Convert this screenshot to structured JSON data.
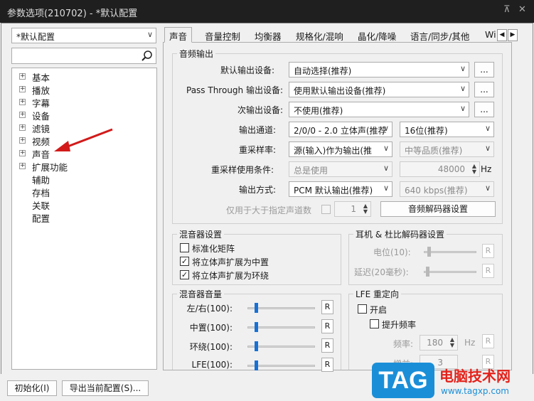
{
  "window": {
    "title": "参数选项(210702) - *默认配置",
    "pin_icon": "pin-icon",
    "close_icon": "close-icon"
  },
  "sidebar": {
    "profile_select": "*默认配置",
    "search_icon": "search-icon",
    "tree": [
      {
        "label": "基本",
        "expandable": true
      },
      {
        "label": "播放",
        "expandable": true
      },
      {
        "label": "字幕",
        "expandable": true
      },
      {
        "label": "设备",
        "expandable": true
      },
      {
        "label": "滤镜",
        "expandable": true
      },
      {
        "label": "视频",
        "expandable": true
      },
      {
        "label": "声音",
        "expandable": true
      },
      {
        "label": "扩展功能",
        "expandable": true
      },
      {
        "label": "辅助",
        "expandable": false
      },
      {
        "label": "存档",
        "expandable": false
      },
      {
        "label": "关联",
        "expandable": false
      },
      {
        "label": "配置",
        "expandable": false
      }
    ]
  },
  "tabs": [
    "声音",
    "音量控制",
    "均衡器",
    "规格化/混响",
    "晶化/降噪",
    "语言/同步/其他",
    "Wi"
  ],
  "audio_output": {
    "title": "音频输出",
    "default_device_label": "默认输出设备:",
    "default_device_value": "自动选择(推荐)",
    "passthrough_label": "Pass Through 输出设备:",
    "passthrough_value": "使用默认输出设备(推荐)",
    "secondary_label": "次输出设备:",
    "secondary_value": "不使用(推荐)",
    "ellipsis": "...",
    "channel_label": "输出通道:",
    "channel_value": "2/0/0 - 2.0 立体声(推荐",
    "bit_value": "16位(推荐)",
    "resample_label": "重采样率:",
    "resample_value": "源(输入)作为输出(推",
    "quality_value": "中等品质(推荐)",
    "resample_cond_label": "重采样使用条件:",
    "resample_cond_value": "总是使用",
    "rate_value": "48000",
    "rate_unit": "Hz",
    "output_mode_label": "输出方式:",
    "output_mode_value": "PCM 默认输出(推荐)",
    "bitrate_value": "640 kbps(推荐)",
    "channels_only_label": "仅用于大于指定声道数",
    "channels_only_value": "1",
    "decoder_button": "音频解码器设置"
  },
  "mixer": {
    "title": "混音器设置",
    "items": [
      {
        "label": "标准化矩阵",
        "checked": false
      },
      {
        "label": "将立体声扩展为中置",
        "checked": true
      },
      {
        "label": "将立体声扩展为环绕",
        "checked": true
      }
    ]
  },
  "headphone": {
    "title": "耳机 & 杜比解码器设置",
    "level_label": "电位(10):",
    "delay_label": "延迟(20毫秒):",
    "reset": "R"
  },
  "mixer_volume": {
    "title": "混音器音量",
    "rows": [
      {
        "label": "左/右(100):",
        "level": 0.11
      },
      {
        "label": "中置(100):",
        "level": 0.11
      },
      {
        "label": "环绕(100):",
        "level": 0.11
      },
      {
        "label": "LFE(100):",
        "level": 0.11
      }
    ],
    "reset": "R"
  },
  "lfe": {
    "title": "LFE 重定向",
    "enable_label": "开启",
    "boost_label": "提升频率",
    "freq_label": "频率:",
    "freq_value": "180",
    "freq_unit": "Hz",
    "gain_label": "增益:",
    "gain_value": "3",
    "reset": "R"
  },
  "footer": {
    "init_button": "初始化(I)",
    "export_button": "导出当前配置(S)..."
  },
  "watermark": {
    "logo": "TAG",
    "site_name": "电脑技术网",
    "url": "www.tagxp.com"
  },
  "colors": {
    "title_bg": "#1f1f1f",
    "accent": "#1671d6",
    "arrow": "#d21a1a",
    "watermark_blue": "#1a8fd8",
    "watermark_red": "#e3221b"
  }
}
